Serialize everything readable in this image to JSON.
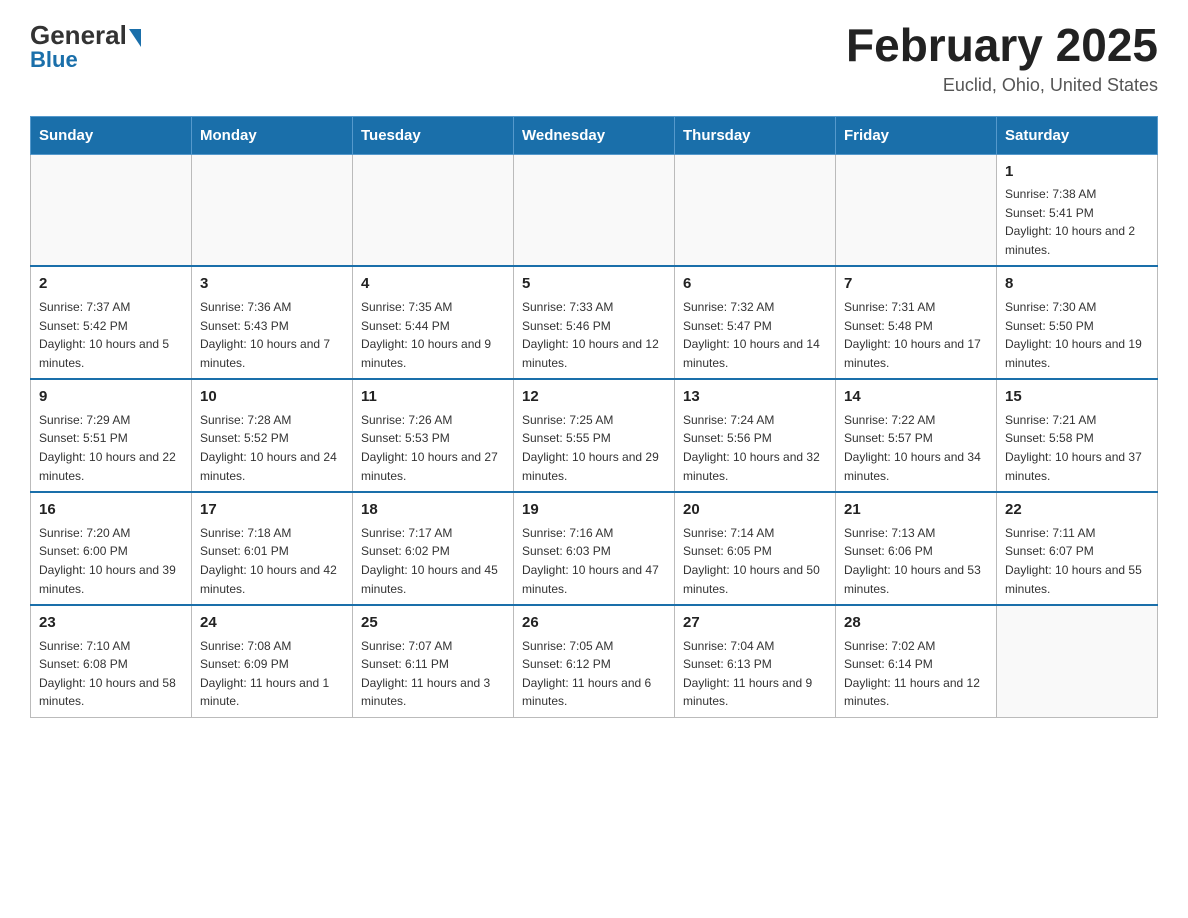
{
  "logo": {
    "general": "General",
    "blue": "Blue"
  },
  "title": "February 2025",
  "location": "Euclid, Ohio, United States",
  "weekdays": [
    "Sunday",
    "Monday",
    "Tuesday",
    "Wednesday",
    "Thursday",
    "Friday",
    "Saturday"
  ],
  "weeks": [
    [
      {
        "day": "",
        "info": ""
      },
      {
        "day": "",
        "info": ""
      },
      {
        "day": "",
        "info": ""
      },
      {
        "day": "",
        "info": ""
      },
      {
        "day": "",
        "info": ""
      },
      {
        "day": "",
        "info": ""
      },
      {
        "day": "1",
        "info": "Sunrise: 7:38 AM\nSunset: 5:41 PM\nDaylight: 10 hours and 2 minutes."
      }
    ],
    [
      {
        "day": "2",
        "info": "Sunrise: 7:37 AM\nSunset: 5:42 PM\nDaylight: 10 hours and 5 minutes."
      },
      {
        "day": "3",
        "info": "Sunrise: 7:36 AM\nSunset: 5:43 PM\nDaylight: 10 hours and 7 minutes."
      },
      {
        "day": "4",
        "info": "Sunrise: 7:35 AM\nSunset: 5:44 PM\nDaylight: 10 hours and 9 minutes."
      },
      {
        "day": "5",
        "info": "Sunrise: 7:33 AM\nSunset: 5:46 PM\nDaylight: 10 hours and 12 minutes."
      },
      {
        "day": "6",
        "info": "Sunrise: 7:32 AM\nSunset: 5:47 PM\nDaylight: 10 hours and 14 minutes."
      },
      {
        "day": "7",
        "info": "Sunrise: 7:31 AM\nSunset: 5:48 PM\nDaylight: 10 hours and 17 minutes."
      },
      {
        "day": "8",
        "info": "Sunrise: 7:30 AM\nSunset: 5:50 PM\nDaylight: 10 hours and 19 minutes."
      }
    ],
    [
      {
        "day": "9",
        "info": "Sunrise: 7:29 AM\nSunset: 5:51 PM\nDaylight: 10 hours and 22 minutes."
      },
      {
        "day": "10",
        "info": "Sunrise: 7:28 AM\nSunset: 5:52 PM\nDaylight: 10 hours and 24 minutes."
      },
      {
        "day": "11",
        "info": "Sunrise: 7:26 AM\nSunset: 5:53 PM\nDaylight: 10 hours and 27 minutes."
      },
      {
        "day": "12",
        "info": "Sunrise: 7:25 AM\nSunset: 5:55 PM\nDaylight: 10 hours and 29 minutes."
      },
      {
        "day": "13",
        "info": "Sunrise: 7:24 AM\nSunset: 5:56 PM\nDaylight: 10 hours and 32 minutes."
      },
      {
        "day": "14",
        "info": "Sunrise: 7:22 AM\nSunset: 5:57 PM\nDaylight: 10 hours and 34 minutes."
      },
      {
        "day": "15",
        "info": "Sunrise: 7:21 AM\nSunset: 5:58 PM\nDaylight: 10 hours and 37 minutes."
      }
    ],
    [
      {
        "day": "16",
        "info": "Sunrise: 7:20 AM\nSunset: 6:00 PM\nDaylight: 10 hours and 39 minutes."
      },
      {
        "day": "17",
        "info": "Sunrise: 7:18 AM\nSunset: 6:01 PM\nDaylight: 10 hours and 42 minutes."
      },
      {
        "day": "18",
        "info": "Sunrise: 7:17 AM\nSunset: 6:02 PM\nDaylight: 10 hours and 45 minutes."
      },
      {
        "day": "19",
        "info": "Sunrise: 7:16 AM\nSunset: 6:03 PM\nDaylight: 10 hours and 47 minutes."
      },
      {
        "day": "20",
        "info": "Sunrise: 7:14 AM\nSunset: 6:05 PM\nDaylight: 10 hours and 50 minutes."
      },
      {
        "day": "21",
        "info": "Sunrise: 7:13 AM\nSunset: 6:06 PM\nDaylight: 10 hours and 53 minutes."
      },
      {
        "day": "22",
        "info": "Sunrise: 7:11 AM\nSunset: 6:07 PM\nDaylight: 10 hours and 55 minutes."
      }
    ],
    [
      {
        "day": "23",
        "info": "Sunrise: 7:10 AM\nSunset: 6:08 PM\nDaylight: 10 hours and 58 minutes."
      },
      {
        "day": "24",
        "info": "Sunrise: 7:08 AM\nSunset: 6:09 PM\nDaylight: 11 hours and 1 minute."
      },
      {
        "day": "25",
        "info": "Sunrise: 7:07 AM\nSunset: 6:11 PM\nDaylight: 11 hours and 3 minutes."
      },
      {
        "day": "26",
        "info": "Sunrise: 7:05 AM\nSunset: 6:12 PM\nDaylight: 11 hours and 6 minutes."
      },
      {
        "day": "27",
        "info": "Sunrise: 7:04 AM\nSunset: 6:13 PM\nDaylight: 11 hours and 9 minutes."
      },
      {
        "day": "28",
        "info": "Sunrise: 7:02 AM\nSunset: 6:14 PM\nDaylight: 11 hours and 12 minutes."
      },
      {
        "day": "",
        "info": ""
      }
    ]
  ]
}
